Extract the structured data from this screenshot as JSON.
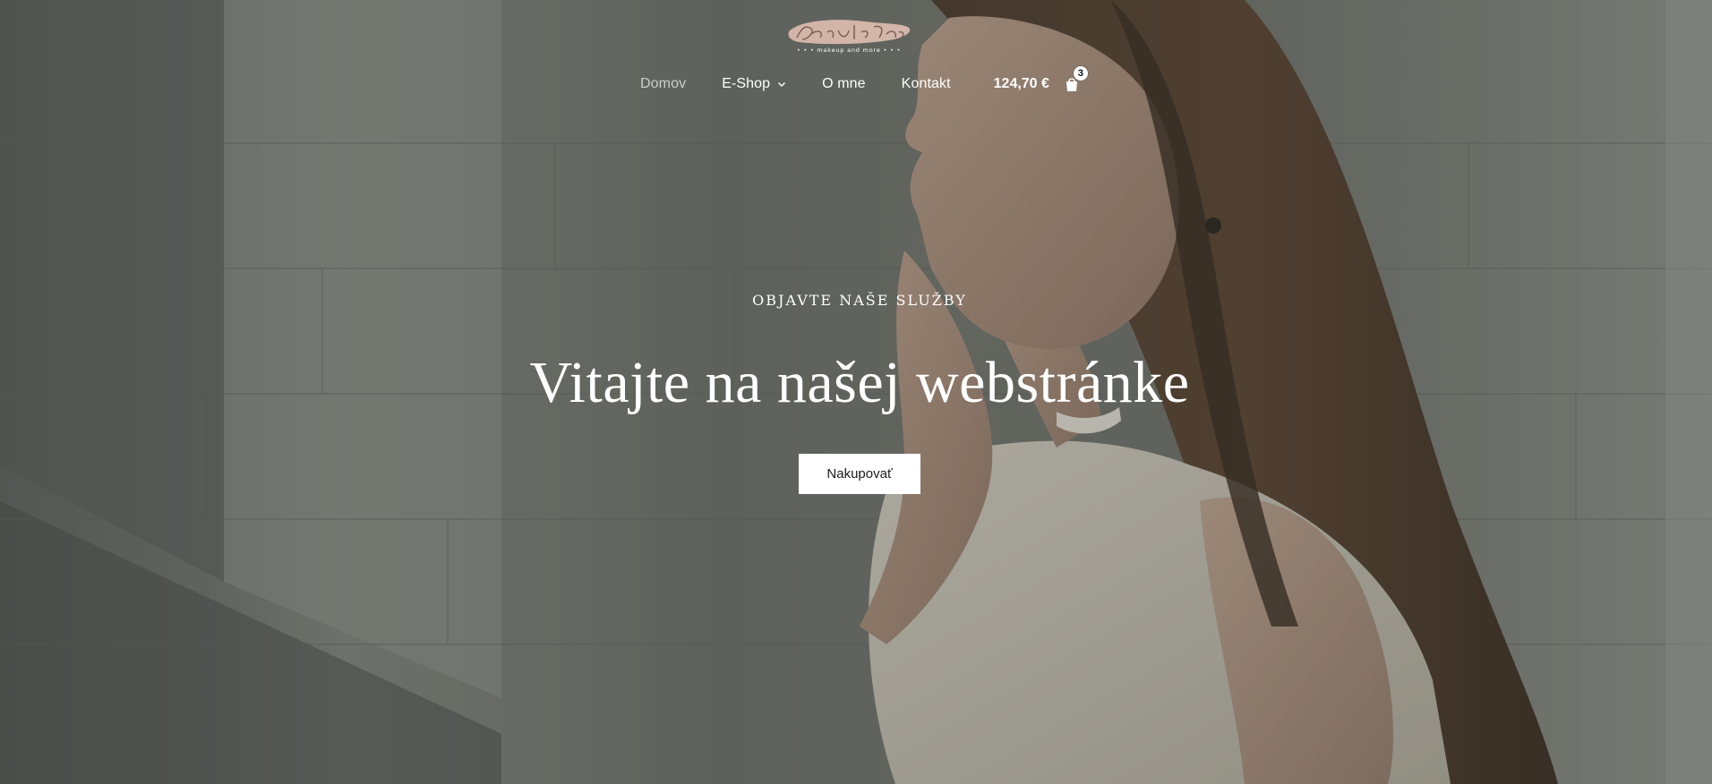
{
  "header": {
    "logo_alt": "Beauty by Tina — makeup and more"
  },
  "nav": {
    "items": [
      {
        "label": "Domov",
        "active": true
      },
      {
        "label": "E-Shop",
        "has_dropdown": true
      },
      {
        "label": "O mne"
      },
      {
        "label": "Kontakt"
      }
    ],
    "cart": {
      "total": "124,70 €",
      "count": "3",
      "icon": "shopping-bag-icon"
    }
  },
  "hero": {
    "eyebrow": "OBJAVTE NAŠE SLUŽBY",
    "title": "Vitajte na našej webstránke",
    "cta_label": "Nakupovať"
  },
  "colors": {
    "text": "#ffffff",
    "nav_active": "#cfcfcb",
    "button_bg": "#ffffff",
    "button_text": "#1a1a1a",
    "logo_brush": "#e8c3b6"
  }
}
